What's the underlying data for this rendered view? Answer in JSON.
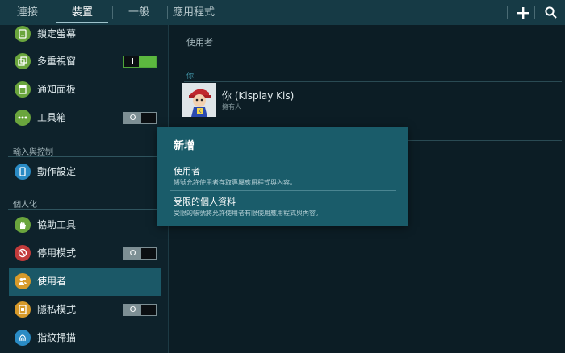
{
  "colors": {
    "accent": "#1b5867",
    "toggle_on": "#5cb83f",
    "dialog_bg": "#1a5c6a",
    "topbar_bg": "#163a45"
  },
  "topbar": {
    "tabs": [
      {
        "label": "連接"
      },
      {
        "label": "裝置"
      },
      {
        "label": "一般"
      },
      {
        "label": "應用程式"
      }
    ],
    "active_tab": "裝置",
    "add_icon": "plus-icon",
    "search_icon": "search-icon"
  },
  "sidebar": {
    "items": [
      {
        "label": "鎖定螢幕",
        "icon": "lock-screen-icon"
      },
      {
        "label": "多重視窗",
        "icon": "multi-window-icon",
        "toggle": "on",
        "toggle_mark": "I"
      },
      {
        "label": "通知面板",
        "icon": "notification-panel-icon"
      },
      {
        "label": "工具箱",
        "icon": "toolbox-icon",
        "toggle": "off",
        "toggle_mark": "O"
      },
      {
        "label": "動作設定",
        "icon": "motion-icon"
      },
      {
        "label": "協助工具",
        "icon": "accessibility-icon"
      },
      {
        "label": "停用模式",
        "icon": "blocking-mode-icon",
        "toggle": "off",
        "toggle_mark": "O"
      },
      {
        "label": "使用者",
        "icon": "users-icon"
      },
      {
        "label": "隱私模式",
        "icon": "private-mode-icon",
        "toggle": "off",
        "toggle_mark": "O"
      },
      {
        "label": "指紋掃描",
        "icon": "fingerprint-icon"
      }
    ],
    "sections": {
      "input": "輸入與控制",
      "personal": "個人化"
    },
    "selected": "使用者"
  },
  "main": {
    "title": "使用者",
    "section_you": "你",
    "user": {
      "name": "你 (Kisplay Kis)",
      "role": "擁有人"
    }
  },
  "dialog": {
    "title": "新增",
    "options": [
      {
        "title": "使用者",
        "subtitle": "帳號允許使用者存取專屬應用程式與內容。"
      },
      {
        "title": "受限的個人資料",
        "subtitle": "受限的帳號將允許使用者有限使用應用程式與內容。"
      }
    ]
  }
}
